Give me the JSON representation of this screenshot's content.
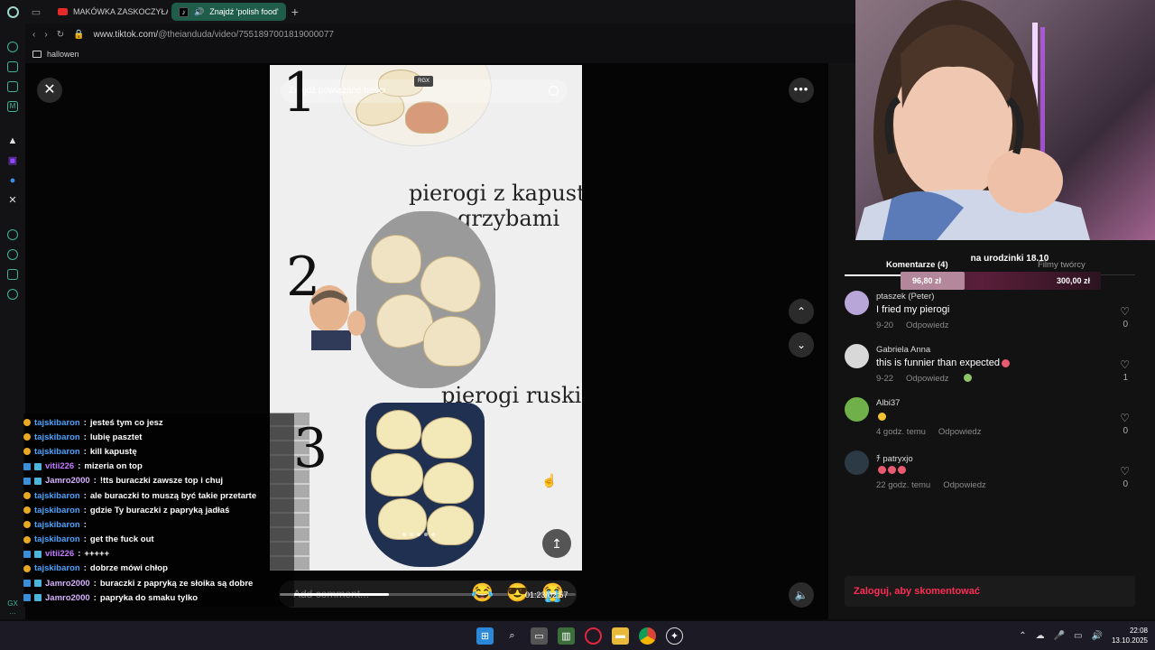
{
  "browser": {
    "tabs": [
      {
        "label": "MAKÓWKA ZASKOCZYŁA",
        "active": false
      },
      {
        "label": "Znajdź 'polish food'",
        "active": true
      }
    ],
    "url_host": "www.tiktok.com/",
    "url_path": "@theianduda/video/7551897001819000077",
    "bookmark_folder": "hallowen"
  },
  "video": {
    "search_placeholder": "Znajdź powiązane treści",
    "rgx_badge": "RGX",
    "numbers": [
      "1",
      "2",
      "3"
    ],
    "titles": [
      "pierogi z kapustą",
      "grzybami",
      "pierogi ruskie"
    ],
    "comment_placeholder": "Add comment...",
    "timecode": "01:23/02:57",
    "progress_fraction": 0.37
  },
  "chat": [
    {
      "user": "tajskibaron",
      "msg": "jesteś tym co jesz",
      "style": "b"
    },
    {
      "user": "tajskibaron",
      "msg": "lubię pasztet",
      "style": "b"
    },
    {
      "user": "tajskibaron",
      "msg": "kill kapustę",
      "style": "b"
    },
    {
      "user": "vitii226",
      "msg": "mizeria on top",
      "style": "v"
    },
    {
      "user": "Jamro2000",
      "msg": "!tts buraczki zawsze top i chuj",
      "style": "j"
    },
    {
      "user": "tajskibaron",
      "msg": "ale buraczki to muszą być takie przetarte",
      "style": "b"
    },
    {
      "user": "tajskibaron",
      "msg": "gdzie Ty buraczki z papryką jadłaś",
      "style": "b"
    },
    {
      "user": "tajskibaron",
      "msg": "",
      "style": "b"
    },
    {
      "user": "tajskibaron",
      "msg": "get the fuck out",
      "style": "b"
    },
    {
      "user": "vitii226",
      "msg": "+++++",
      "style": "v"
    },
    {
      "user": "tajskibaron",
      "msg": "dobrze mówi chłop",
      "style": "b"
    },
    {
      "user": "Jamro2000",
      "msg": "buraczki z papryką ze słoika są dobre",
      "style": "j"
    },
    {
      "user": "Jamro2000",
      "msg": "papryka do smaku tylko",
      "style": "j"
    }
  ],
  "panel": {
    "tab_comments": "Komentarze (4)",
    "tab_creator": "Filmy twórcy",
    "login_cta": "Zaloguj, aby skomentować",
    "comments": [
      {
        "author": "ptaszek (Peter)",
        "text": "I fried my pierogi",
        "date": "9-20",
        "reply": "Odpowiedz",
        "likes": "0",
        "avatar_color": "#b9a6d8"
      },
      {
        "author": "Gabriela Anna",
        "text": "this is funnier than expected",
        "date": "9-22",
        "reply": "Odpowiedz",
        "likes": "1",
        "avatar_color": "#d8d8d8"
      },
      {
        "author": "Albi37",
        "text": "",
        "date": "4 godz. temu",
        "reply": "Odpowiedz",
        "likes": "0",
        "avatar_color": "#6fb04a"
      },
      {
        "author": "ﾁ patryxjo",
        "text": "",
        "date": "22 godz. temu",
        "reply": "Odpowiedz",
        "likes": "0",
        "avatar_color": "#2b3a44"
      }
    ]
  },
  "goal": {
    "title": "na urodzinki 18.10",
    "current": "96,80 zł",
    "target": "300,00 zł",
    "fraction": 0.32
  },
  "taskbar": {
    "time": "22:08",
    "date": "13.10.2025"
  },
  "colors": {
    "accent_green": "#1f5d4a",
    "tiktok_red": "#fe2c55"
  }
}
